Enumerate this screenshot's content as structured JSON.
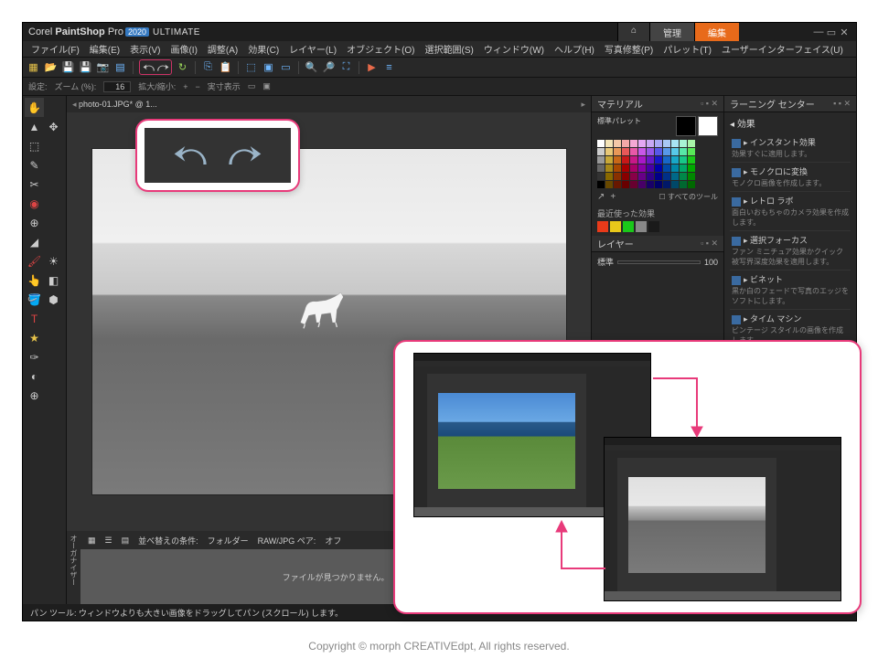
{
  "app": {
    "brand_prefix": "Corel",
    "brand_main": "PaintShop",
    "brand_suffix": "Pro",
    "year": "2020",
    "edition": "ULTIMATE"
  },
  "tabs": {
    "home_glyph": "⌂",
    "manage": "管理",
    "edit": "編集"
  },
  "menubar": [
    "ファイル(F)",
    "編集(E)",
    "表示(V)",
    "画像(I)",
    "調整(A)",
    "効果(C)",
    "レイヤー(L)",
    "オブジェクト(O)",
    "選択範囲(S)",
    "ウィンドウ(W)",
    "ヘルプ(H)",
    "写真修整(P)",
    "パレット(T)",
    "ユーザーインターフェイス(U)"
  ],
  "optbar": {
    "label_settings": "設定:",
    "label_zoom": "ズーム (%):",
    "zoom_value": "16",
    "label_actual": "拡大/縮小:",
    "label_reset": "実寸表示"
  },
  "doc": {
    "tab": "photo-01.JPG* @ 1..."
  },
  "panels": {
    "material": {
      "title": "マテリアル",
      "palette_label": "標準パレット",
      "recent": "最近使った効果",
      "alltools": "すべてのツール"
    },
    "layers": {
      "title": "レイヤー",
      "mode": "標準",
      "opacity": "100"
    },
    "learning": {
      "title": "ラーニング センター",
      "section": "効果",
      "items": [
        {
          "t": "インスタント効果",
          "d": "効果すぐに適用します。"
        },
        {
          "t": "モノクロに変換",
          "d": "モノクロ画像を作成します。"
        },
        {
          "t": "レトロ ラボ",
          "d": "面白いおもちゃのカメラ効果を作成します。"
        },
        {
          "t": "選択フォーカス",
          "d": "ファン ミニチュア効果かクイック被写界深度効果を適用します。"
        },
        {
          "t": "ビネット",
          "d": "黒か白のフェードで写真のエッジをソフトにします。"
        },
        {
          "t": "タイム マシン",
          "d": "ビンテージ スタイルの画像を作成します。"
        }
      ]
    }
  },
  "organizer": {
    "sort_label": "並べ替えの条件:",
    "sort_value": "フォルダー",
    "pair_label": "RAW/JPG ペア:",
    "pair_value": "オフ",
    "empty": "ファイルが見つかりません。",
    "tab": "オーガナイザー"
  },
  "status": "パン ツール: ウィンドウよりも大きい画像をドラッグしてパン (スクロール) します。",
  "palette_colors": [
    "#ffffff",
    "#f4e4b8",
    "#f4c8a8",
    "#f4a8a8",
    "#f4a8d4",
    "#e4a8f4",
    "#c8a8f4",
    "#a8a8f4",
    "#a8c8f4",
    "#a8e4f4",
    "#a8f4d4",
    "#a8f4a8",
    "#cccccc",
    "#e8c878",
    "#e89858",
    "#e85858",
    "#e858a8",
    "#c858e8",
    "#9858e8",
    "#5858e8",
    "#5898e8",
    "#58c8e8",
    "#58e8a8",
    "#58e858",
    "#999999",
    "#c8a838",
    "#c86818",
    "#c81818",
    "#c81888",
    "#a818c8",
    "#6818c8",
    "#1818c8",
    "#1868c8",
    "#18a8c8",
    "#18c888",
    "#18c818",
    "#666666",
    "#a88818",
    "#a84800",
    "#a80000",
    "#a80068",
    "#8800a8",
    "#4800a8",
    "#0000a8",
    "#0048a8",
    "#0088a8",
    "#00a868",
    "#00a800",
    "#333333",
    "#886800",
    "#883000",
    "#880000",
    "#880048",
    "#680088",
    "#300088",
    "#000088",
    "#003088",
    "#006888",
    "#008848",
    "#008800",
    "#000000",
    "#684800",
    "#681800",
    "#680000",
    "#680030",
    "#480068",
    "#180068",
    "#000068",
    "#001868",
    "#004868",
    "#006830",
    "#006800"
  ],
  "recent_colors": [
    "#e83a1a",
    "#e8c81a",
    "#1ac81a",
    "#888888",
    "#1a1a1a"
  ],
  "copyright": "Copyright © morph CREATIVEdpt, All rights reserved."
}
